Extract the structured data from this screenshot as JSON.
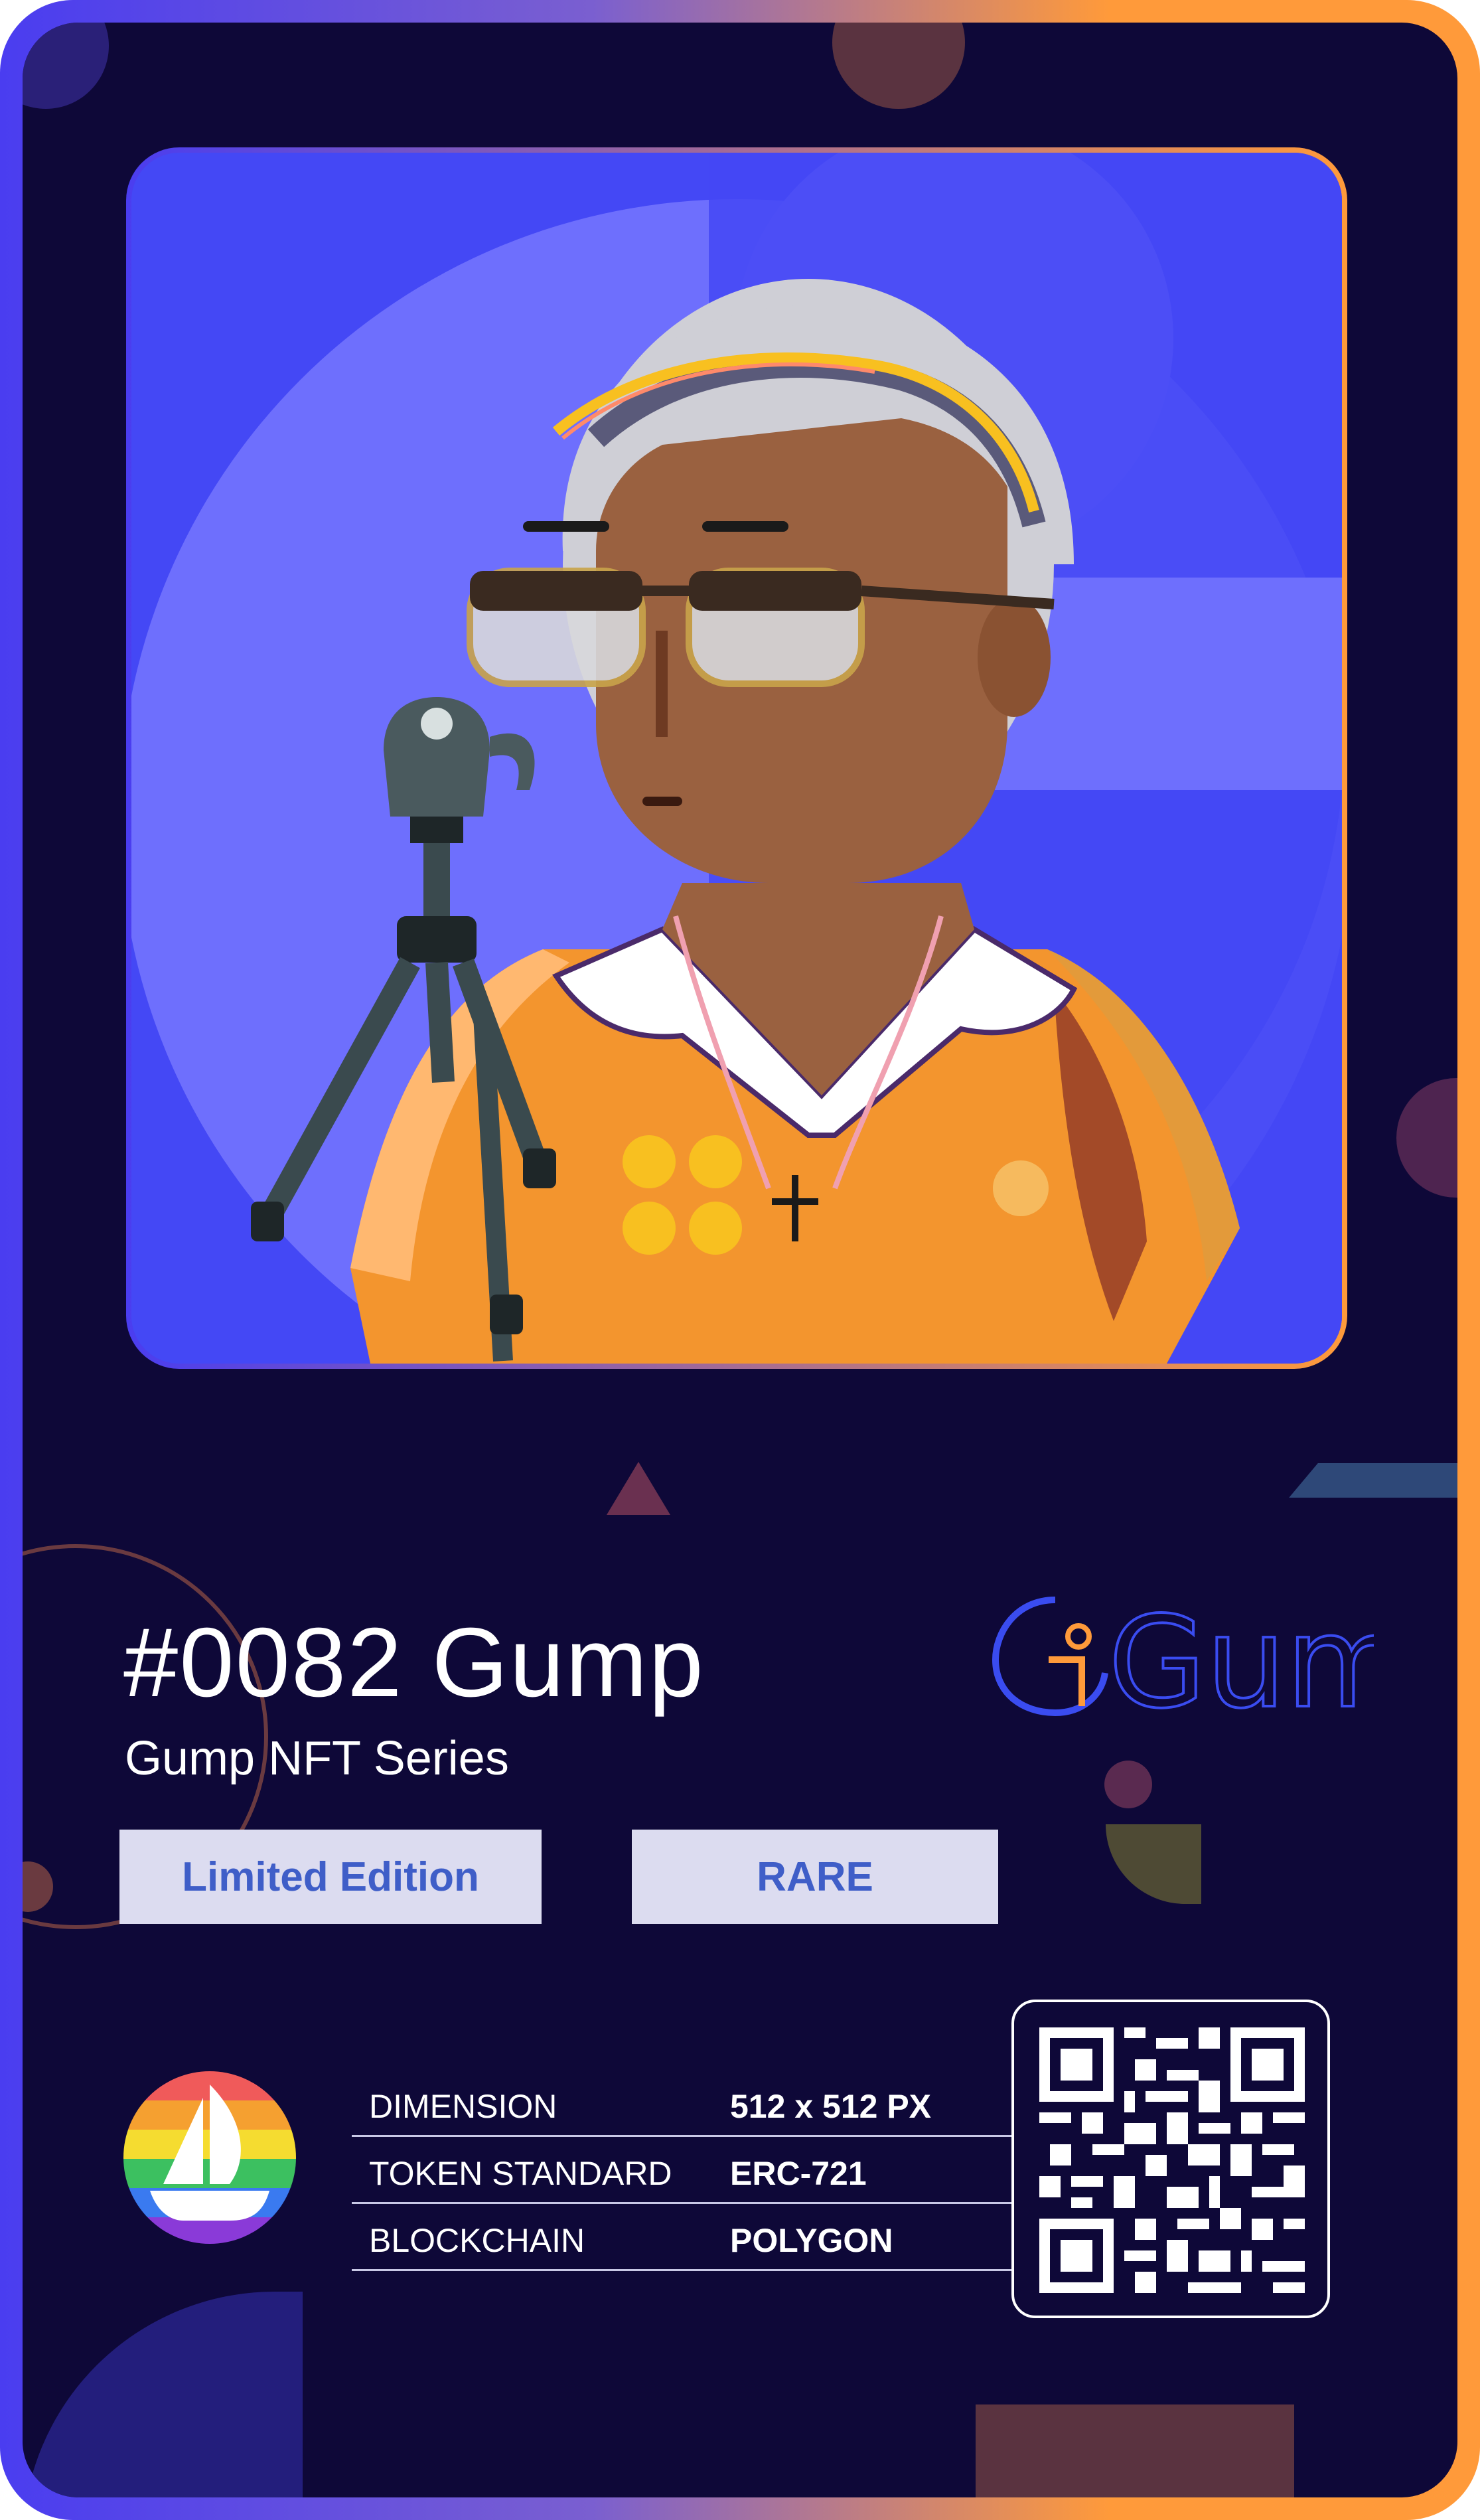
{
  "token": {
    "title": "#0082 Gump",
    "series": "Gump NFT Series"
  },
  "badges": {
    "edition": "Limited Edition",
    "rarity": "RARE"
  },
  "brand": {
    "logo_text": "Gump",
    "marketplace_icon": "opensea-icon"
  },
  "specs": [
    {
      "label": "DIMENSION",
      "value": "512 x 512 PX"
    },
    {
      "label": "TOKEN STANDARD",
      "value": "ERC-721"
    },
    {
      "label": "BLOCKCHAIN",
      "value": "POLYGON"
    }
  ],
  "colors": {
    "card_background": "#0e0838",
    "accent_orange": "#ff9a3a",
    "accent_blue": "#4a3df0",
    "badge_background": "#dcdcf0",
    "badge_text": "#3f5ec8"
  }
}
